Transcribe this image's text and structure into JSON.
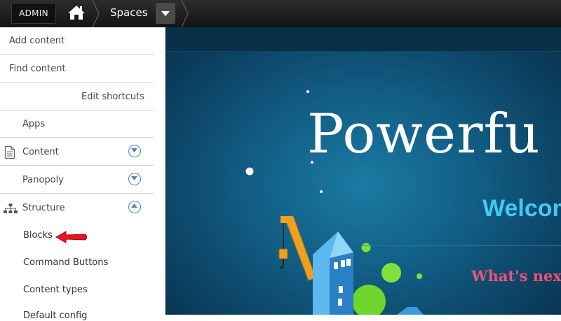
{
  "toolbar": {
    "admin_label": "ADMIN",
    "breadcrumb": "Spaces"
  },
  "menu": {
    "add_content": "Add content",
    "find_content": "Find content",
    "edit_shortcuts": "Edit shortcuts",
    "apps": "Apps",
    "content": "Content",
    "panopoly": "Panopoly",
    "structure": "Structure",
    "structure_items": [
      "Blocks",
      "Command Buttons",
      "Content types",
      "Default config"
    ]
  },
  "hero": {
    "title": "Powerfu",
    "welcome": "Welcom",
    "whats_next": "What's next"
  },
  "colors": {
    "toolbar": "#1e1e1e",
    "accent_blue": "#4a86c9",
    "welcome": "#44c8f5",
    "whats_next": "#f0507a",
    "arrow": "#e8141e"
  }
}
